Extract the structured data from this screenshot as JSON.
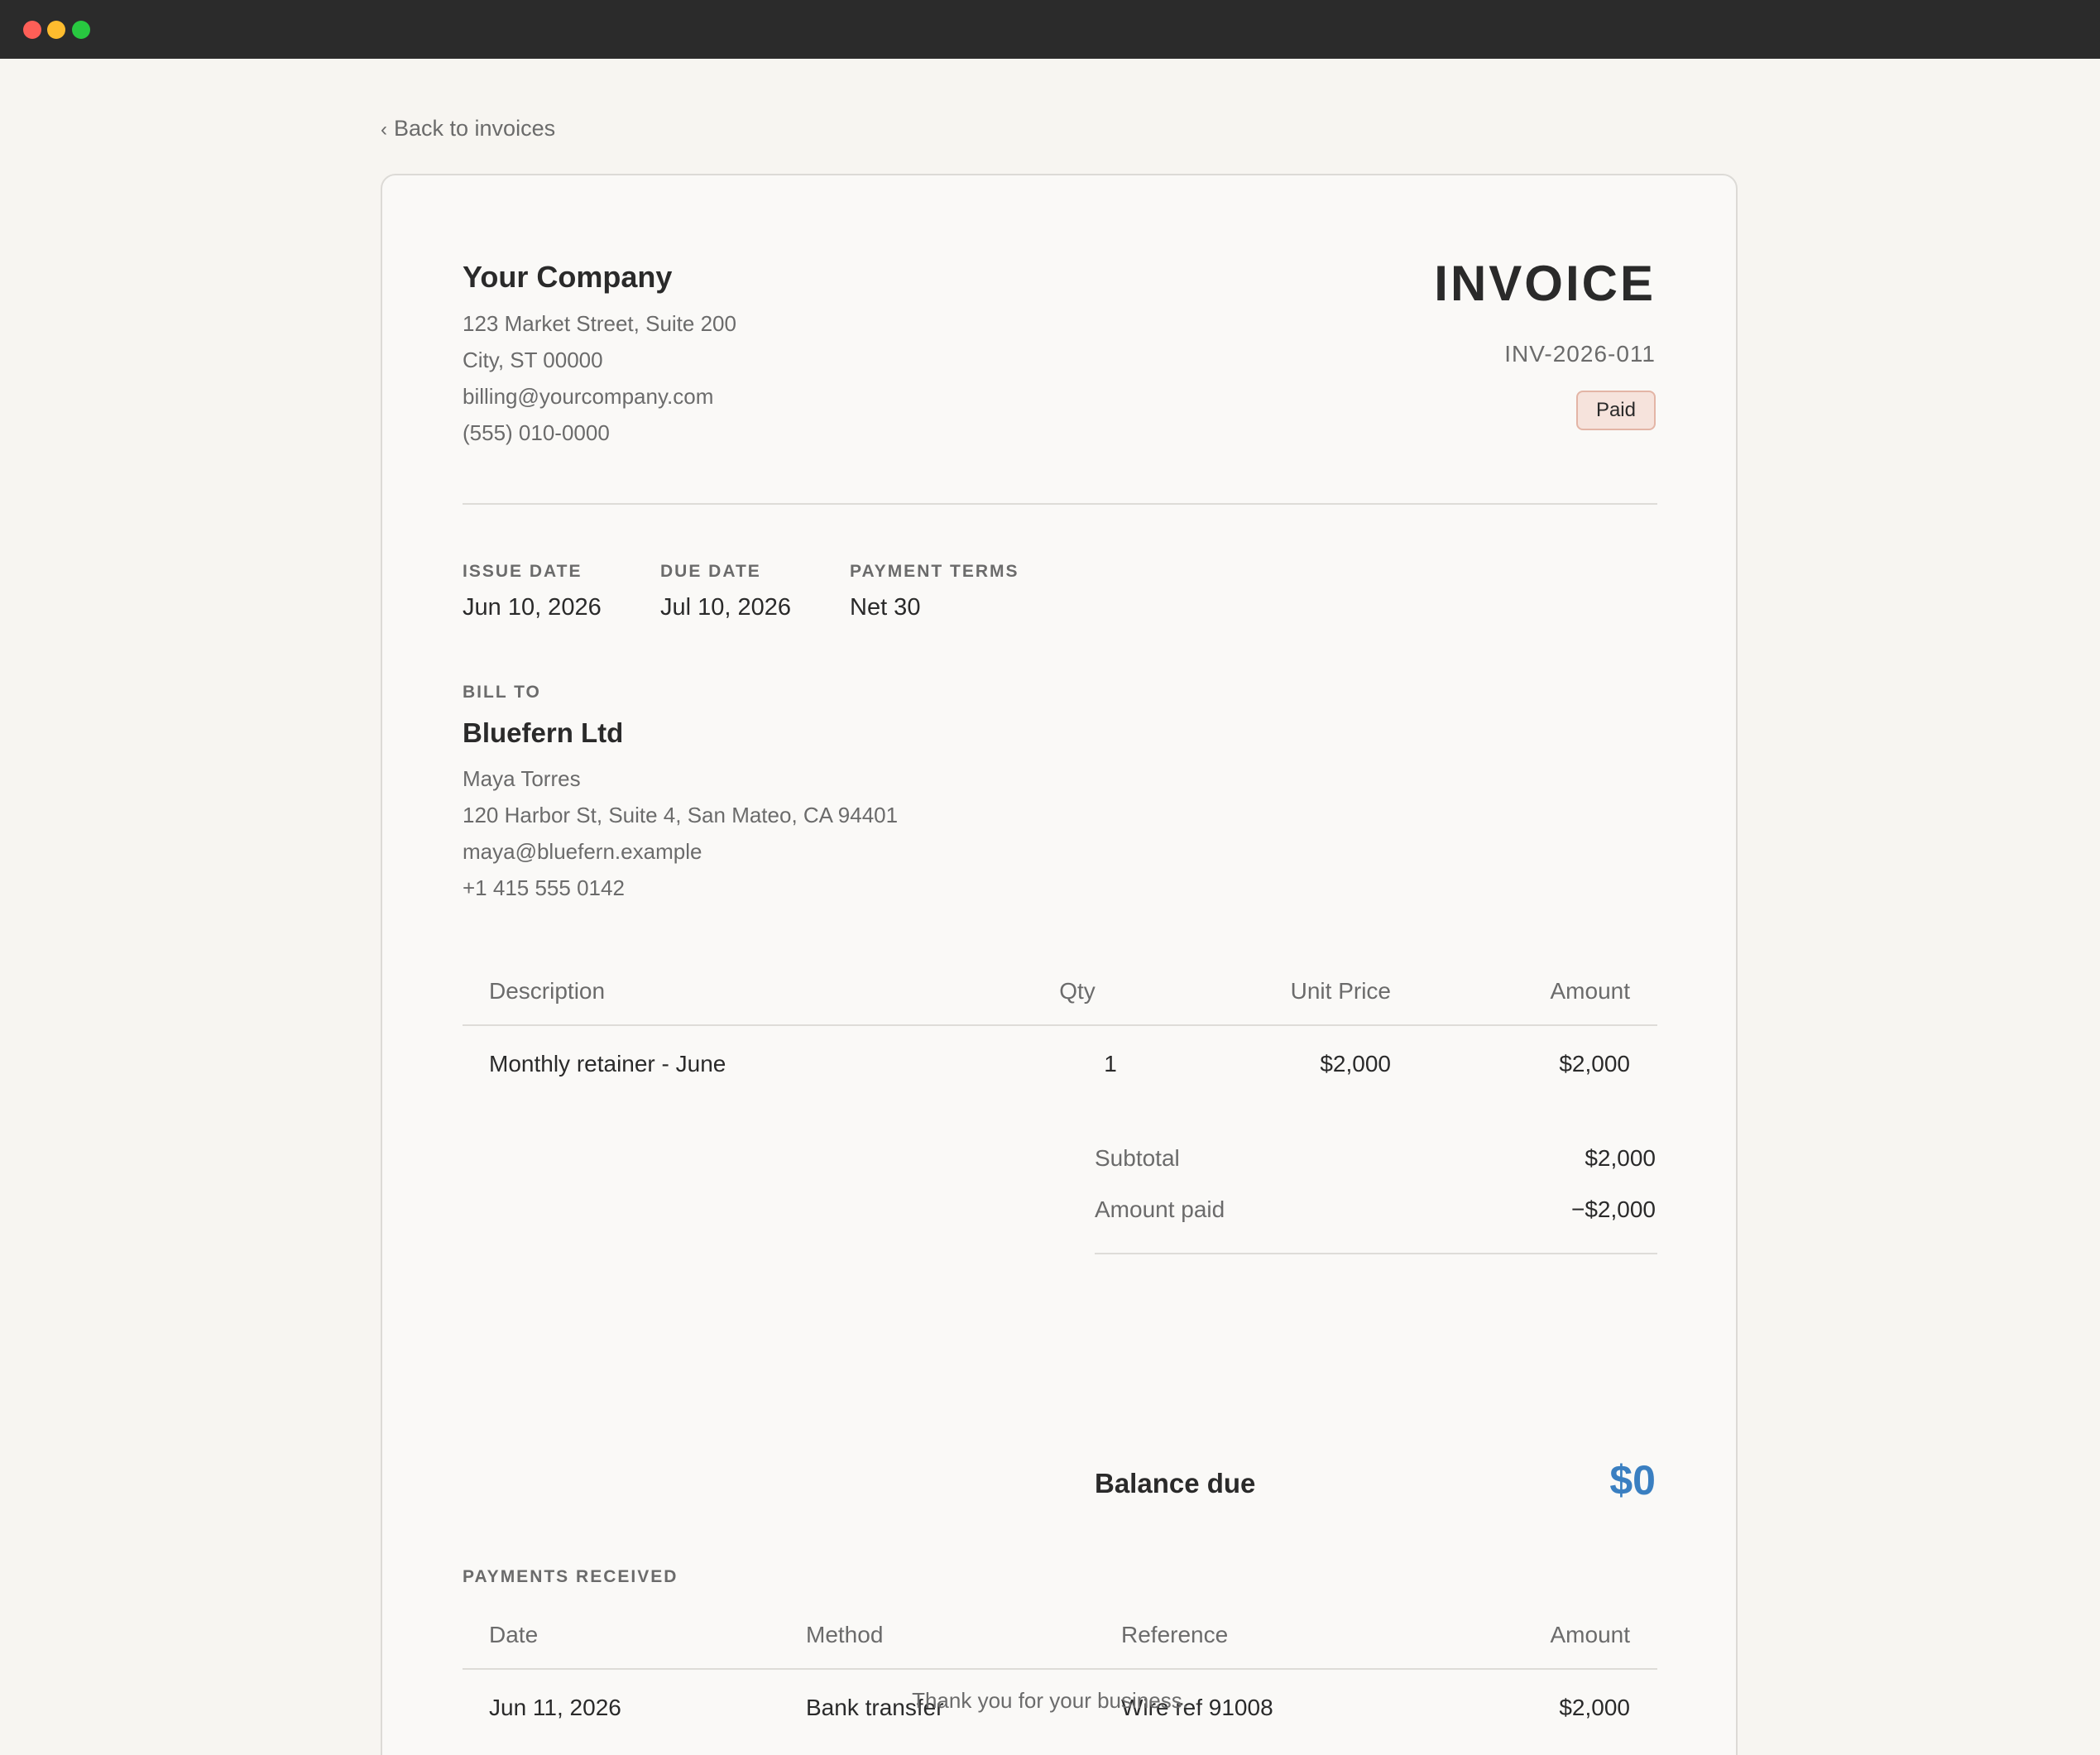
{
  "nav": {
    "back_label": "Back to invoices"
  },
  "company": {
    "name": "Your Company",
    "address1": "123 Market Street, Suite 200",
    "address2": "City, ST 00000",
    "email": "billing@yourcompany.com",
    "phone": "(555) 010-0000"
  },
  "invoice": {
    "title": "INVOICE",
    "number": "INV-2026-011",
    "status": "Paid",
    "status_color": "#f6e3dc"
  },
  "meta": {
    "issue_date_label": "ISSUE DATE",
    "issue_date": "Jun 10, 2026",
    "due_date_label": "DUE DATE",
    "due_date": "Jul 10, 2026",
    "terms_label": "PAYMENT TERMS",
    "terms": "Net 30"
  },
  "bill_to": {
    "label": "BILL TO",
    "name": "Bluefern Ltd",
    "contact": "Maya Torres",
    "address": "120 Harbor St, Suite 4, San Mateo, CA 94401",
    "email": "maya@bluefern.example",
    "phone": "+1 415 555 0142"
  },
  "line_items": {
    "headers": {
      "description": "Description",
      "qty": "Qty",
      "unit_price": "Unit Price",
      "amount": "Amount"
    },
    "rows": [
      {
        "description": "Monthly retainer - June",
        "qty": "1",
        "unit_price": "$2,000",
        "amount": "$2,000"
      }
    ]
  },
  "totals": {
    "subtotal_label": "Subtotal",
    "subtotal": "$2,000",
    "paid_label": "Amount paid",
    "paid": "−$2,000",
    "balance_label": "Balance due",
    "balance": "$0",
    "balance_color": "#3a7fc1"
  },
  "payments": {
    "label": "PAYMENTS RECEIVED",
    "headers": {
      "date": "Date",
      "method": "Method",
      "reference": "Reference",
      "amount": "Amount"
    },
    "rows": [
      {
        "date": "Jun 11, 2026",
        "method": "Bank transfer",
        "reference": "Wire ref 91008",
        "amount": "$2,000"
      }
    ]
  },
  "footer": {
    "note": "Thank you for your business."
  }
}
